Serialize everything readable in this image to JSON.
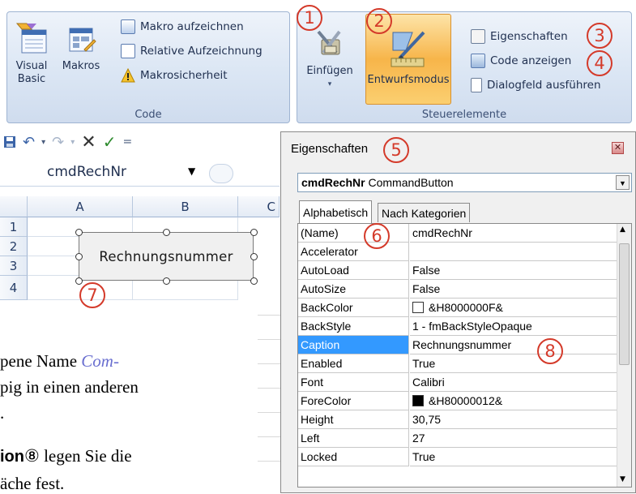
{
  "ribbon": {
    "code_group": {
      "label": "Code",
      "visual_basic": "Visual Basic",
      "makros": "Makros",
      "record_macro": "Makro aufzeichnen",
      "relative_recording": "Relative Aufzeichnung",
      "macro_security": "Makrosicherheit"
    },
    "controls_group": {
      "label": "Steuerelemente",
      "insert": "Einfügen",
      "design_mode": "Entwurfsmodus",
      "properties": "Eigenschaften",
      "view_code": "Code anzeigen",
      "run_dialog": "Dialogfeld ausführen"
    }
  },
  "callouts": [
    "1",
    "2",
    "3",
    "4",
    "5",
    "6",
    "7",
    "8"
  ],
  "quick_access": {
    "save_icon": "save-icon",
    "undo_icon": "undo-icon",
    "redo_icon": "redo-icon",
    "cancel_mark": "✕",
    "enter_mark": "✓",
    "customize_mark": "="
  },
  "namebox": {
    "value": "cmdRechNr"
  },
  "sheet": {
    "columns": [
      "A",
      "B",
      "C"
    ],
    "rows": [
      "1",
      "2",
      "3",
      "4"
    ],
    "button_caption": "Rechnungsnummer"
  },
  "properties_window": {
    "title": "Eigenschaften",
    "object_name": "cmdRechNr",
    "object_type": "CommandButton",
    "tabs": [
      "Alphabetisch",
      "Nach Kategorien"
    ],
    "rows": [
      {
        "name": "(Name)",
        "value": "cmdRechNr"
      },
      {
        "name": "Accelerator",
        "value": ""
      },
      {
        "name": "AutoLoad",
        "value": "False"
      },
      {
        "name": "AutoSize",
        "value": "False"
      },
      {
        "name": "BackColor",
        "value": "&H8000000F&"
      },
      {
        "name": "BackStyle",
        "value": "1 - fmBackStyleOpaque"
      },
      {
        "name": "Caption",
        "value": "Rechnungsnummer"
      },
      {
        "name": "Enabled",
        "value": "True"
      },
      {
        "name": "Font",
        "value": "Calibri"
      },
      {
        "name": "ForeColor",
        "value": "&H80000012&"
      },
      {
        "name": "Height",
        "value": "30,75"
      },
      {
        "name": "Left",
        "value": "27"
      },
      {
        "name": "Locked",
        "value": "True"
      }
    ],
    "backcolor_swatch": "#ffffff",
    "forecolor_swatch": "#000000"
  },
  "text_fragments": {
    "line1_a": "pene Name ",
    "line1_b": "Com-",
    "line2": "pig in einen anderen",
    "line3": ".",
    "line4_a": "ion",
    "line4_circle": "⑧",
    "line4_b": " legen Sie die",
    "line5": "äche fest."
  },
  "colors": {
    "accent_red": "#d43a2a",
    "design_mode_active": "#f7b54a",
    "selection_blue": "#3399ff"
  }
}
